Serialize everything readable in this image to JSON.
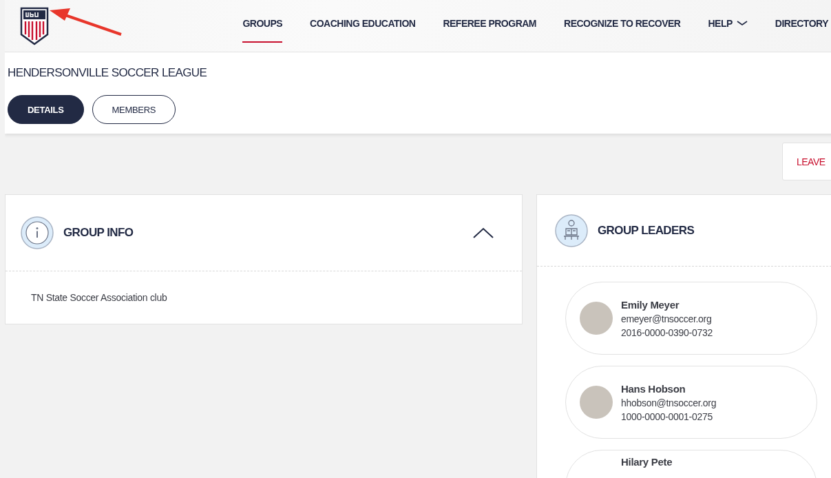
{
  "nav": {
    "items": [
      {
        "label": "GROUPS",
        "selected": true,
        "kind": "link"
      },
      {
        "label": "COACHING EDUCATION",
        "selected": false,
        "kind": "link"
      },
      {
        "label": "REFEREE PROGRAM",
        "selected": false,
        "kind": "link"
      },
      {
        "label": "RECOGNIZE TO RECOVER",
        "selected": false,
        "kind": "link"
      },
      {
        "label": "HELP",
        "selected": false,
        "kind": "menu"
      },
      {
        "label": "DIRECTORY",
        "selected": false,
        "kind": "link"
      }
    ]
  },
  "group": {
    "title": "HENDERSONVILLE SOCCER LEAGUE",
    "tabs": [
      {
        "label": "DETAILS",
        "selected": true
      },
      {
        "label": "MEMBERS",
        "selected": false
      }
    ]
  },
  "leave_button": {
    "label": "LEAVE"
  },
  "group_info": {
    "title": "GROUP INFO",
    "expanded": true,
    "description": "TN State Soccer Association club"
  },
  "group_leaders": {
    "title": "GROUP LEADERS",
    "leaders": [
      {
        "name": "Emily Meyer",
        "email": "emeyer@tnsoccer.org",
        "id": "2016-0000-0390-0732"
      },
      {
        "name": "Hans Hobson",
        "email": "hhobson@tnsoccer.org",
        "id": "1000-0000-0001-0275"
      },
      {
        "name": "Hilary Pete"
      }
    ]
  }
}
